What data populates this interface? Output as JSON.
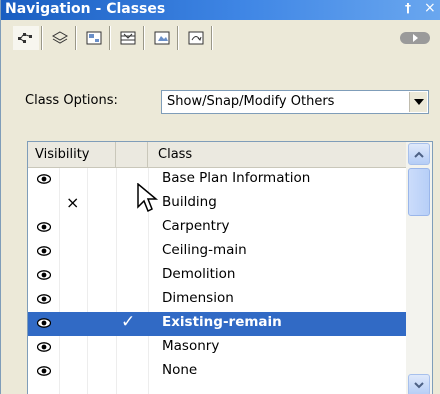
{
  "window": {
    "title": "Navigation - Classes",
    "pin_glyph": "†",
    "close_glyph": "×"
  },
  "tabs": [
    {
      "name": "classes-tab-icon",
      "active": true
    },
    {
      "name": "layers-tab-icon",
      "active": false
    },
    {
      "name": "sheet-layers-tab-icon",
      "active": false
    },
    {
      "name": "viewports-tab-icon",
      "active": false
    },
    {
      "name": "saved-views-tab-icon",
      "active": false
    },
    {
      "name": "references-tab-icon",
      "active": false
    }
  ],
  "class_options": {
    "label": "Class Options:",
    "value": "Show/Snap/Modify Others"
  },
  "columns": {
    "visibility": "Visibility",
    "blank": "",
    "class": "Class"
  },
  "rows": [
    {
      "visible": true,
      "x_mark": "",
      "check": "",
      "name": "Base Plan Information",
      "selected": false
    },
    {
      "visible": false,
      "x_mark": "×",
      "check": "",
      "name": "Building",
      "selected": false
    },
    {
      "visible": true,
      "x_mark": "",
      "check": "",
      "name": "Carpentry",
      "selected": false
    },
    {
      "visible": true,
      "x_mark": "",
      "check": "",
      "name": "Ceiling-main",
      "selected": false
    },
    {
      "visible": true,
      "x_mark": "",
      "check": "",
      "name": "Demolition",
      "selected": false
    },
    {
      "visible": true,
      "x_mark": "",
      "check": "",
      "name": "Dimension",
      "selected": false
    },
    {
      "visible": true,
      "x_mark": "",
      "check": "✓",
      "name": "Existing-remain",
      "selected": true
    },
    {
      "visible": true,
      "x_mark": "",
      "check": "",
      "name": "Masonry",
      "selected": false
    },
    {
      "visible": true,
      "x_mark": "",
      "check": "",
      "name": "None",
      "selected": false
    }
  ],
  "colors": {
    "title_bar": "#1a5ec1",
    "selection": "#316ac5",
    "border": "#7f9db9",
    "panel": "#ece9d8"
  }
}
